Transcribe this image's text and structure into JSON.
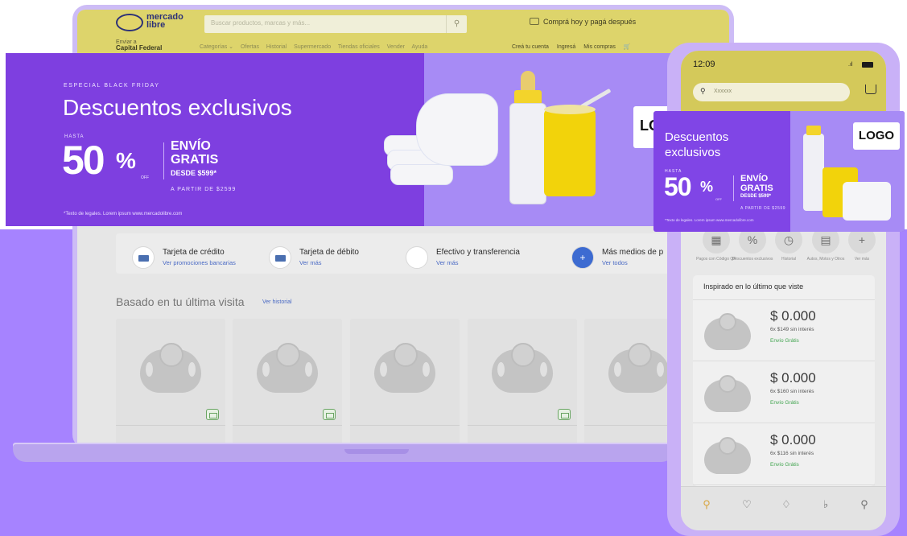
{
  "laptop": {
    "header": {
      "logo_text_1": "mercado",
      "logo_text_2": "libre",
      "search_placeholder": "Buscar productos, marcas y más...",
      "search_icon": "search-icon",
      "promo": "Comprá hoy y pagá después",
      "location_small": "Enviar a",
      "location": "Capital Federal",
      "nav": [
        "Categorías ⌄",
        "Ofertas",
        "Historial",
        "Supermercado",
        "Tiendas oficiales",
        "Vender",
        "Ayuda"
      ],
      "user": [
        "Creá tu cuenta",
        "Ingresá",
        "Mis compras"
      ]
    },
    "payments": [
      {
        "title": "Tarjeta de crédito",
        "link": "Ver promociones bancarias"
      },
      {
        "title": "Tarjeta de débito",
        "link": "Ver más"
      },
      {
        "title": "Efectivo y transferencia",
        "link": "Ver más"
      },
      {
        "title": "Más medios de p",
        "link": "Ver todos"
      }
    ],
    "section": {
      "title": "Basado en tu última visita",
      "link": "Ver historial"
    },
    "products_count_visible": 5
  },
  "banner": {
    "kicker": "ESPECIAL BLACK FRIDAY",
    "title": "Descuentos exclusivos",
    "hasta": "HASTA",
    "percent": "50",
    "percent_sign": "%",
    "off": "OFF",
    "envio_1": "ENVÍO",
    "envio_2": "GRATIS",
    "desde": "DESDE $599*",
    "a_partir": "A PARTIR DE $2599",
    "legal": "*Texto de legales. Lorem ipsum www.mercadolibre.com",
    "logo": "LO"
  },
  "phone": {
    "time": "12:09",
    "search_placeholder": "Xxxxxx",
    "banner": {
      "title_1": "Descuentos",
      "title_2": "exclusivos",
      "hasta": "HASTA",
      "percent": "50",
      "percent_sign": "%",
      "off": "OFF",
      "envio_1": "ENVÍO",
      "envio_2": "GRATIS",
      "desde": "DESDE $599*",
      "a_partir": "A PARTIR DE $2599",
      "legal": "*Texto de legales. Lorem ipsum www.mercadolibre.com",
      "logo": "LOGO"
    },
    "shortcuts": [
      {
        "icon": "qr-icon",
        "label": "Pagos con Código QR"
      },
      {
        "icon": "discount-icon",
        "label": "Descuentos exclusivos"
      },
      {
        "icon": "clock-icon",
        "label": "Historial"
      },
      {
        "icon": "car-icon",
        "label": "Autos, Motos y Otros"
      },
      {
        "icon": "plus-icon",
        "label": "Ver más"
      }
    ],
    "list_title": "Inspirado en lo último que viste",
    "items": [
      {
        "price": "$ 0.000",
        "installments": "6x $149 sin interés",
        "shipping": "Envío Grátis"
      },
      {
        "price": "$ 0.000",
        "installments": "6x $160 sin interés",
        "shipping": "Envío Grátis"
      },
      {
        "price": "$ 0.000",
        "installments": "6x $116 sin interés",
        "shipping": "Envío Grátis"
      }
    ],
    "tabs": [
      "search-icon",
      "heart-icon",
      "tag-icon",
      "bell-icon",
      "user-icon"
    ]
  },
  "colors": {
    "brand_purple": "#7e3fe0",
    "background_lilac": "#a683ff",
    "ml_yellow": "#ddd46b",
    "shipping_green": "#3fa34d"
  }
}
